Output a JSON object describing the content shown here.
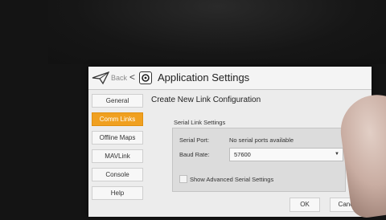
{
  "header": {
    "back_label": "Back",
    "back_chevron": "<",
    "title": "Application Settings",
    "plane_icon": "paper-plane-icon",
    "app_icon": "qgc-app-icon"
  },
  "sidebar": {
    "items": [
      {
        "label": "General",
        "active": false
      },
      {
        "label": "Comm Links",
        "active": true
      },
      {
        "label": "Offline Maps",
        "active": false
      },
      {
        "label": "MAVLink",
        "active": false
      },
      {
        "label": "Console",
        "active": false
      },
      {
        "label": "Help",
        "active": false
      }
    ]
  },
  "main": {
    "title": "Create New Link Configuration",
    "section_title": "Serial Link Settings",
    "serial_port_label": "Serial Port:",
    "serial_port_value": "No serial ports available",
    "baud_rate_label": "Baud Rate:",
    "baud_rate_value": "57600",
    "show_advanced_label": "Show Advanced Serial Settings",
    "show_advanced_checked": false
  },
  "footer": {
    "ok_label": "OK",
    "cancel_label": "Cancel"
  },
  "colors": {
    "accent": "#f0a020",
    "screen_bg": "#ececec"
  }
}
